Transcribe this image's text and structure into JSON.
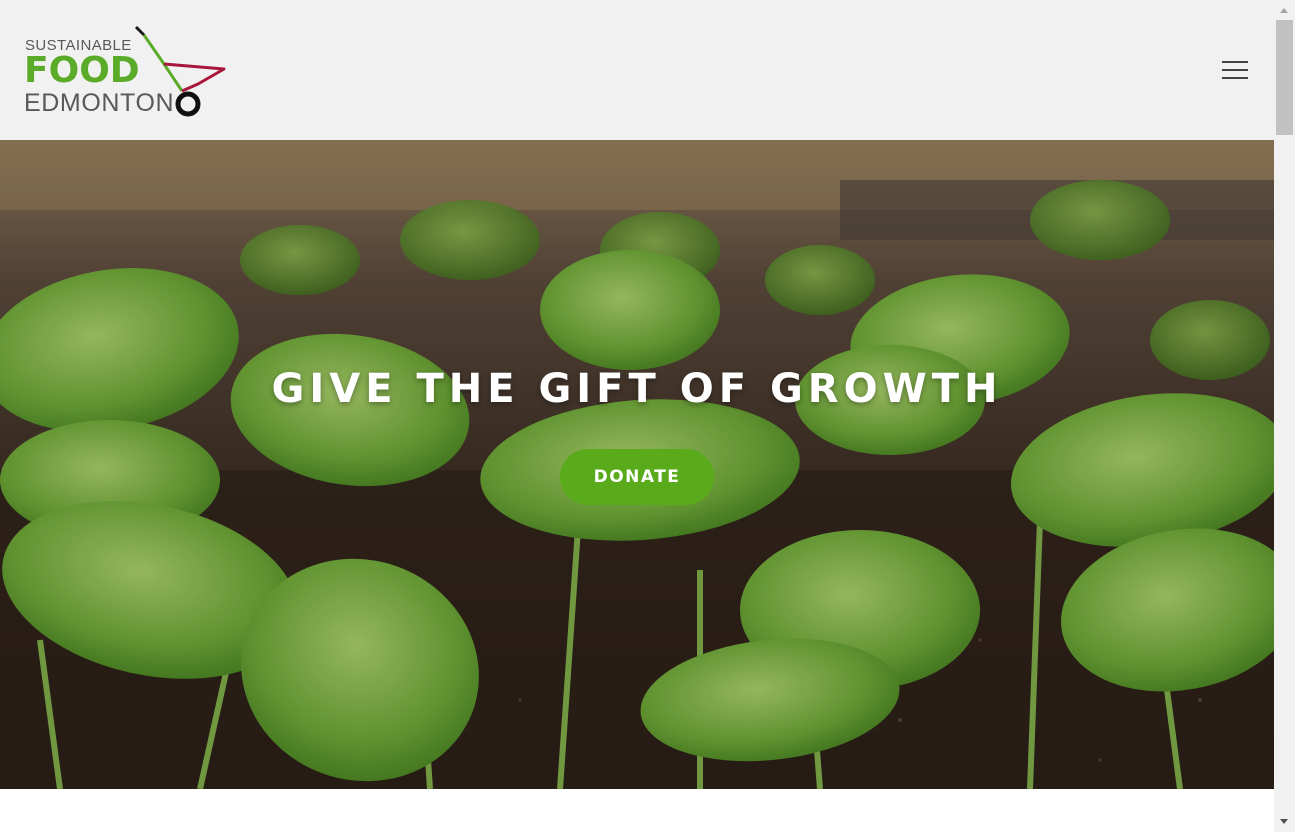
{
  "brand": {
    "line1": "SUSTAINABLE",
    "line2": "FOOD",
    "line3": "EDMONTON",
    "colors": {
      "green": "#5aab28",
      "gray": "#58595b",
      "red": "#a8173b"
    }
  },
  "header": {
    "menu_icon": "hamburger-menu-icon"
  },
  "hero": {
    "title": "GIVE THE GIFT OF GROWTH",
    "donate_label": "DONATE",
    "background": "basil seedlings in soil",
    "button_color": "#5aab1c"
  }
}
